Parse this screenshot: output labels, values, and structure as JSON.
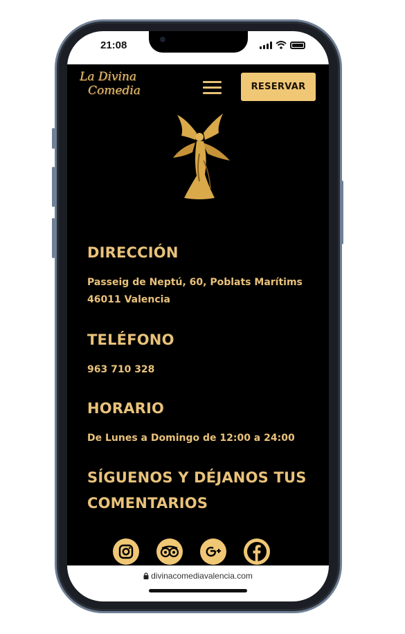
{
  "status_bar": {
    "time": "21:08"
  },
  "header": {
    "logo_line1": "La Divina",
    "logo_line2": "Comedia",
    "reserve_label": "RESERVAR"
  },
  "sections": {
    "address": {
      "title": "DIRECCIÓN",
      "line1": "Passeig de Neptú, 60, Poblats Marítims",
      "line2": "46011 Valencia"
    },
    "phone": {
      "title": "TELÉFONO",
      "value": "963 710 328"
    },
    "hours": {
      "title": "HORARIO",
      "value": "De Lunes a Domingo de 12:00 a 24:00"
    },
    "follow": {
      "title_line1": "SÍGUENOS Y DÉJANOS TUS",
      "title_line2": "COMENTARIOS"
    }
  },
  "social": [
    "instagram-icon",
    "tripadvisor-icon",
    "google-plus-icon",
    "facebook-icon"
  ],
  "browser": {
    "url": "divinacomediavalencia.com"
  },
  "colors": {
    "gold": "#e9c27a",
    "button_gold": "#f0c775",
    "background": "#000000"
  }
}
